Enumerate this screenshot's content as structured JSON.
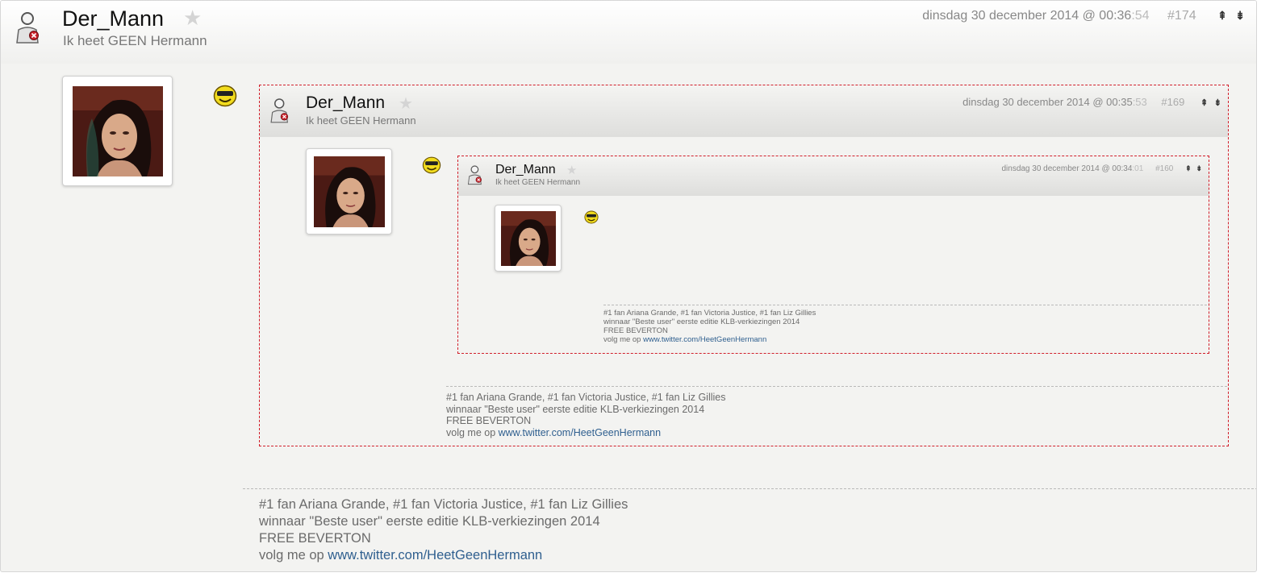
{
  "post": {
    "username": "Der_Mann",
    "user_title": "Ik heet GEEN Hermann",
    "date_main": "dinsdag 30 december 2014 @ 00:36",
    "date_seconds": ":54",
    "post_number": "#174",
    "nav_up": "⇞",
    "nav_down": "⇟"
  },
  "quote1": {
    "username": "Der_Mann",
    "user_title": "Ik heet GEEN Hermann",
    "date_main": "dinsdag 30 december 2014 @ 00:35",
    "date_seconds": ":53",
    "post_number": "#169"
  },
  "quote2": {
    "username": "Der_Mann",
    "user_title": "Ik heet GEEN Hermann",
    "date_main": "dinsdag 30 december 2014 @ 00:34",
    "date_seconds": ":01",
    "post_number": "#160"
  },
  "signature": {
    "line1": "#1 fan Ariana Grande, #1 fan Victoria Justice, #1 fan Liz Gillies",
    "line2": "winnaar \"Beste user\" eerste editie KLB-verkiezingen 2014",
    "line3": "FREE BEVERTON",
    "line4_prefix": "volg me op ",
    "link": "www.twitter.com/HeetGeenHermann"
  },
  "icons": {
    "user": "user-offline-icon",
    "favorite": "star-icon",
    "smiley": "cool-smiley-icon",
    "up": "arrow-up-icon",
    "down": "arrow-down-icon"
  },
  "colors": {
    "quote_border": "#d11e2a",
    "link": "#2f5f8f",
    "smiley": "#f2dc1e"
  }
}
